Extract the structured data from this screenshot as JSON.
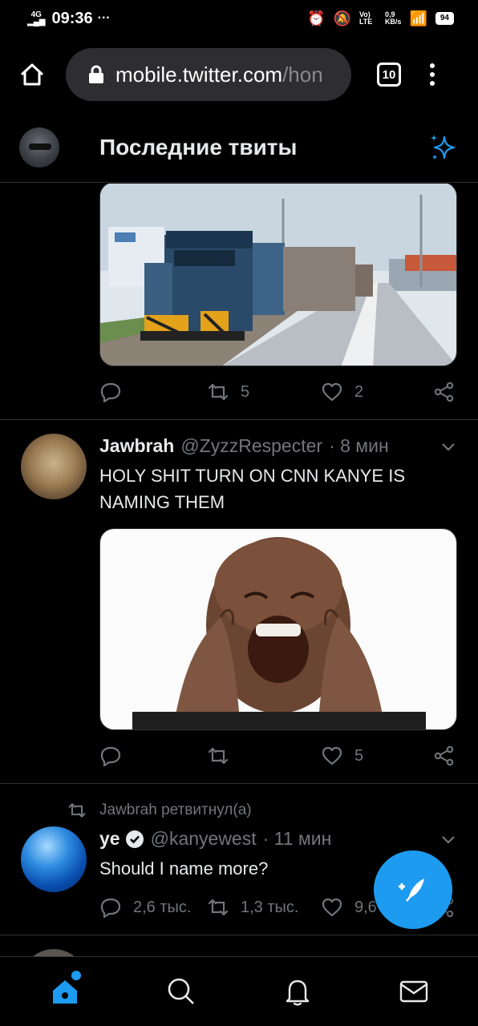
{
  "status_bar": {
    "network": "4G",
    "time": "09:36",
    "more": "···",
    "volte": "Vo) LTE",
    "speed_value": "0,9",
    "speed_unit": "KB/s",
    "battery": "94"
  },
  "browser": {
    "url_host": "mobile.twitter.com",
    "url_rest": "/hon",
    "tab_count": "10"
  },
  "header": {
    "title": "Последние твиты"
  },
  "tweets": [
    {
      "reply_count": "",
      "retweet_count": "5",
      "like_count": "2"
    },
    {
      "name": "Jawbrah",
      "handle": "@ZyzzRespecter",
      "time": "· 8 мин",
      "text": "HOLY SHIT TURN ON CNN KANYE IS NAMING THEM",
      "reply_count": "",
      "retweet_count": "",
      "like_count": "5"
    },
    {
      "retweet_note": "Jawbrah ретвитнул(а)",
      "name": "ye",
      "handle": "@kanyewest",
      "time": "· 11 мин",
      "text": "Should I name more?",
      "reply_count": "2,6 тыс.",
      "retweet_count": "1,3 тыс.",
      "like_count": "9,6"
    }
  ],
  "colors": {
    "accent": "#1d9bf0",
    "background": "#000000",
    "muted": "#71767b",
    "divider": "#2f3336"
  },
  "icons": [
    "home-icon",
    "lock-icon",
    "sparkle-icon",
    "reply-icon",
    "retweet-icon",
    "like-icon",
    "share-icon",
    "verified-icon",
    "compose-icon",
    "search-icon",
    "notifications-icon",
    "messages-icon"
  ]
}
